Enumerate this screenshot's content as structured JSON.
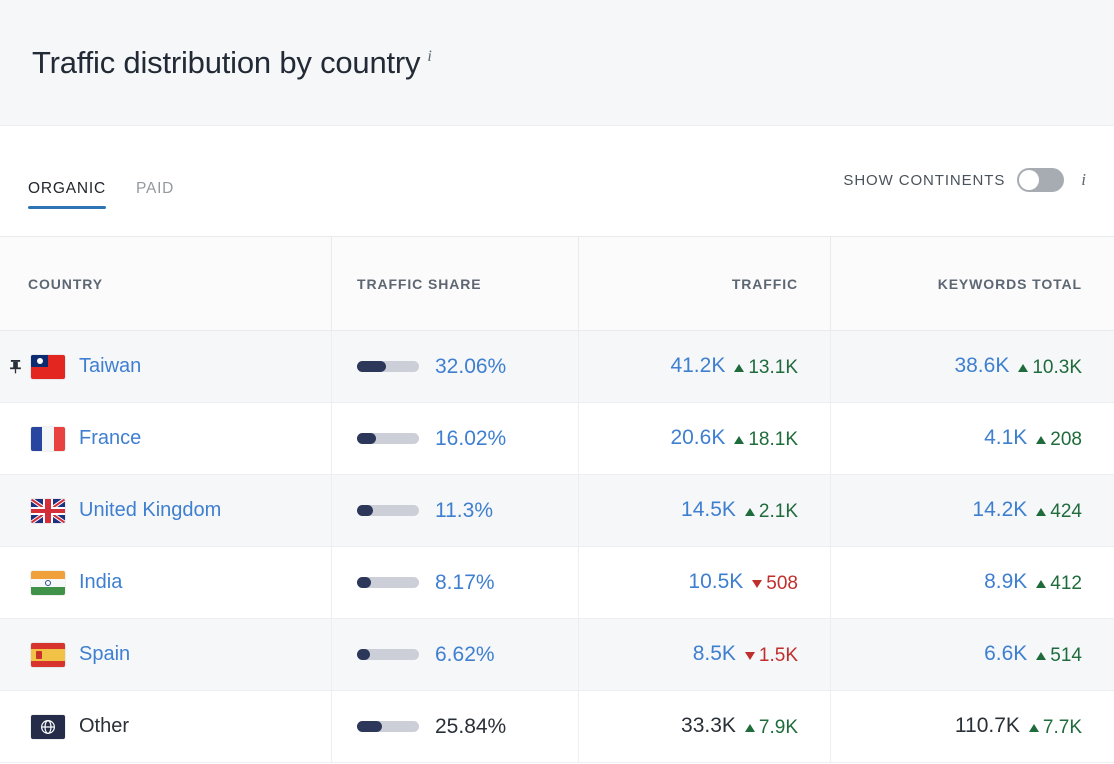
{
  "header": {
    "title": "Traffic distribution by country",
    "info_icon": "info-icon",
    "info_glyph": "i"
  },
  "tabs": [
    {
      "label": "ORGANIC",
      "active": true
    },
    {
      "label": "PAID",
      "active": false
    }
  ],
  "continents_toggle": {
    "label": "SHOW CONTINENTS",
    "state": "off",
    "info_glyph": "i"
  },
  "table": {
    "columns": [
      {
        "key": "country",
        "label": "COUNTRY"
      },
      {
        "key": "share",
        "label": "TRAFFIC SHARE"
      },
      {
        "key": "traffic",
        "label": "TRAFFIC"
      },
      {
        "key": "keywords",
        "label": "KEYWORDS TOTAL"
      }
    ],
    "rows": [
      {
        "pinned": true,
        "pin_icon": "pin-icon",
        "flag_icon": "flag-taiwan-icon",
        "country": "Taiwan",
        "share_pct": "32.06%",
        "share_value": 32.06,
        "traffic": "41.2K",
        "traffic_delta": "13.1K",
        "traffic_dir": "up",
        "keywords": "38.6K",
        "keywords_delta": "10.3K",
        "keywords_dir": "up"
      },
      {
        "pinned": false,
        "flag_icon": "flag-france-icon",
        "country": "France",
        "share_pct": "16.02%",
        "share_value": 16.02,
        "traffic": "20.6K",
        "traffic_delta": "18.1K",
        "traffic_dir": "up",
        "keywords": "4.1K",
        "keywords_delta": "208",
        "keywords_dir": "up"
      },
      {
        "pinned": false,
        "flag_icon": "flag-united-kingdom-icon",
        "country": "United Kingdom",
        "share_pct": "11.3%",
        "share_value": 11.3,
        "traffic": "14.5K",
        "traffic_delta": "2.1K",
        "traffic_dir": "up",
        "keywords": "14.2K",
        "keywords_delta": "424",
        "keywords_dir": "up"
      },
      {
        "pinned": false,
        "flag_icon": "flag-india-icon",
        "country": "India",
        "share_pct": "8.17%",
        "share_value": 8.17,
        "traffic": "10.5K",
        "traffic_delta": "508",
        "traffic_dir": "down",
        "keywords": "8.9K",
        "keywords_delta": "412",
        "keywords_dir": "up"
      },
      {
        "pinned": false,
        "flag_icon": "flag-spain-icon",
        "country": "Spain",
        "share_pct": "6.62%",
        "share_value": 6.62,
        "traffic": "8.5K",
        "traffic_delta": "1.5K",
        "traffic_dir": "down",
        "keywords": "6.6K",
        "keywords_delta": "514",
        "keywords_dir": "up"
      },
      {
        "pinned": false,
        "flag_icon": "globe-icon",
        "country": "Other",
        "is_other": true,
        "share_pct": "25.84%",
        "share_value": 25.84,
        "traffic": "33.3K",
        "traffic_delta": "7.9K",
        "traffic_dir": "up",
        "keywords": "110.7K",
        "keywords_delta": "7.7K",
        "keywords_dir": "up"
      }
    ]
  },
  "colors": {
    "link_blue": "#3f7fd0",
    "accent_blue": "#2e74b5",
    "up_green": "#1f6b3b",
    "down_red": "#bf2f2c",
    "bar_fill": "#2c3759",
    "bar_track": "#ccced8",
    "row_shade": "#f6f7f9",
    "header_bg": "#f6f7f9"
  }
}
